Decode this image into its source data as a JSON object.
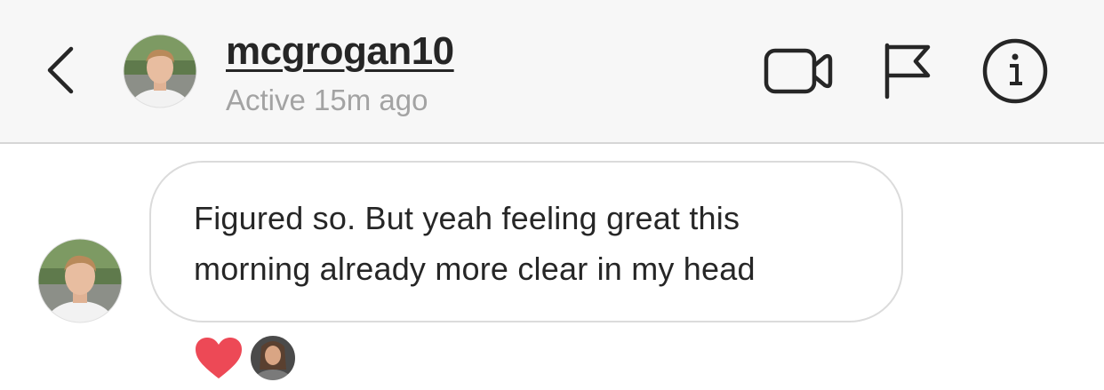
{
  "header": {
    "back_icon": "chevron-left-icon",
    "username": "mcgrogan10",
    "status": "Active 15m ago",
    "icons": [
      "video-camera-icon",
      "flag-icon",
      "info-icon"
    ]
  },
  "thread": {
    "messages": [
      {
        "line1": "Figured so. But yeah feeling great this",
        "line2": "morning already more clear in my head",
        "reaction": "heart-icon"
      }
    ]
  },
  "colors": {
    "header_bg": "#f7f7f7",
    "text": "#262626",
    "muted": "#a3a3a3",
    "bubble_border": "#dbdbdb",
    "heart": "#ed4956"
  }
}
